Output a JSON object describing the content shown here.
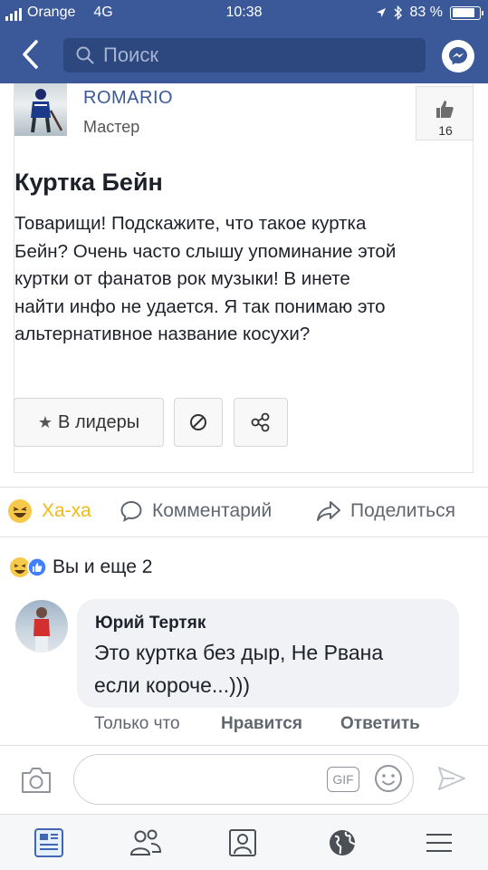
{
  "status_bar": {
    "carrier": "Orange",
    "network": "4G",
    "time": "10:38",
    "battery_percent": "83 %",
    "battery_level": 0.83
  },
  "nav": {
    "back_icon": "chevron-left-icon",
    "search_placeholder": "Поиск",
    "messenger_icon": "messenger-icon",
    "color": "#3b5998"
  },
  "post": {
    "author_name": "ROMARIO",
    "author_rank": "Мастер",
    "like_count": "16",
    "title": "Куртка Бейн",
    "body_lines": [
      "Товарищи! Подскажите, что такое куртка",
      "Бейн? Очень часто слышу упоминание этой",
      "куртки от фанатов рок музыки! В инете",
      "найти инфо не удается. Я так понимаю это",
      "альтернативное название косухи?"
    ],
    "leader_button": "В лидеры"
  },
  "actions": {
    "reaction": "Ха-ха",
    "comment": "Комментарий",
    "share": "Поделиться"
  },
  "reactions_summary": "Вы и еще 2",
  "comment": {
    "author": "Юрий Тертяк",
    "text_lines": [
      "Это куртка без дыр, Не Рвана",
      "если короче...)))"
    ],
    "time": "Только что",
    "like": "Нравится",
    "reply": "Ответить"
  },
  "composer": {
    "gif_label": "GIF"
  }
}
